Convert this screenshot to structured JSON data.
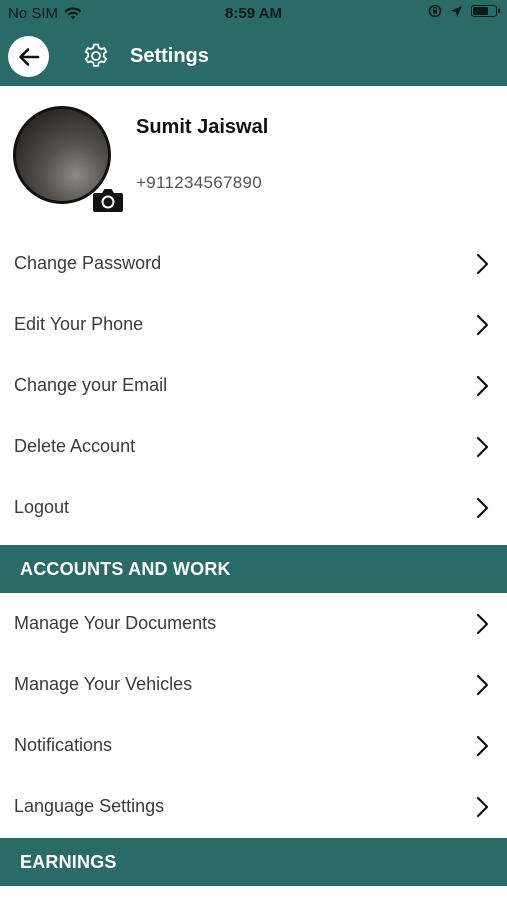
{
  "status_bar": {
    "carrier": "No SIM",
    "time": "8:59 AM",
    "battery_level": 0.72
  },
  "header": {
    "title": "Settings",
    "icons": [
      "back-arrow-icon",
      "gear-icon"
    ]
  },
  "profile": {
    "name": "Sumit Jaiswal",
    "phone": "+911234567890",
    "avatar_icon": "camera-icon"
  },
  "account_items": [
    {
      "label": "Change Password"
    },
    {
      "label": "Edit Your Phone"
    },
    {
      "label": "Change your Email"
    },
    {
      "label": "Delete Account"
    },
    {
      "label": "Logout"
    }
  ],
  "sections": {
    "accounts_and_work": "ACCOUNTS AND WORK",
    "earnings": "EARNINGS"
  },
  "work_items": [
    {
      "label": "Manage Your Documents"
    },
    {
      "label": "Manage Your Vehicles"
    },
    {
      "label": "Notifications"
    },
    {
      "label": "Language Settings"
    }
  ],
  "colors": {
    "header": "#2a6b68",
    "background": "#ffffff",
    "text": "#3b3b3b"
  }
}
